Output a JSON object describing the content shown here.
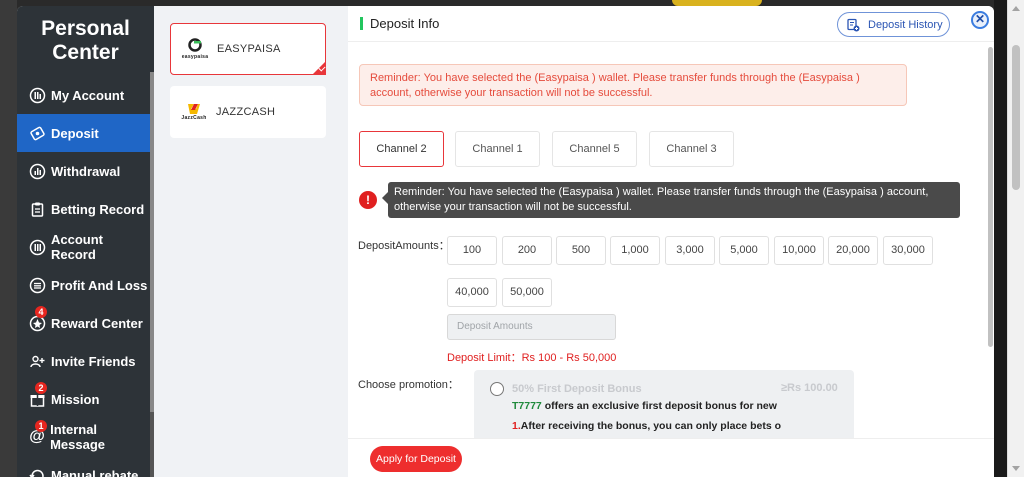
{
  "sidebar": {
    "title_line1": "Personal",
    "title_line2": "Center",
    "items": [
      {
        "label": "My Account"
      },
      {
        "label": "Deposit"
      },
      {
        "label": "Withdrawal"
      },
      {
        "label": "Betting Record"
      },
      {
        "label": "Account Record"
      },
      {
        "label": "Profit And Loss"
      },
      {
        "label": "Reward Center",
        "badge": "4"
      },
      {
        "label": "Invite Friends"
      },
      {
        "label": "Mission",
        "badge": "2"
      },
      {
        "label": "Internal Message",
        "badge": "1"
      },
      {
        "label": "Manual rebate"
      }
    ]
  },
  "wallets": [
    {
      "name": "EASYPAISA",
      "logo_text": "easypaisa",
      "selected": true
    },
    {
      "name": "JAZZCASH",
      "logo_text": "JazzCash",
      "selected": false
    }
  ],
  "header": {
    "title": "Deposit Info",
    "history_label": "Deposit History",
    "close_symbol": "✕"
  },
  "reminder": "Reminder: You have selected the (Easypaisa ) wallet. Please transfer funds through the (Easypaisa ) account, otherwise your transaction will not be successful.",
  "channels": [
    "Channel 2",
    "Channel 1",
    "Channel 5",
    "Channel 3"
  ],
  "tooltip": "Reminder: You have selected the (Easypaisa ) wallet. Please transfer funds through the (Easypaisa ) account, otherwise your transaction will not be successful.",
  "warn_symbol": "!",
  "amounts": {
    "label": "DepositAmounts：",
    "options": [
      "100",
      "200",
      "500",
      "1,000",
      "3,000",
      "5,000",
      "10,000",
      "20,000",
      "30,000",
      "40,000",
      "50,000"
    ],
    "placeholder": "Deposit Amounts",
    "limit_text": "Deposit Limit：Rs  100  - Rs  50,000"
  },
  "promotion": {
    "label": "Choose promotion：",
    "title": "50% First Deposit Bonus",
    "min": "≥Rs  100.00",
    "brand": "T7777",
    "line1_rest": " offers an exclusive first deposit bonus for new",
    "line2_num": "1.",
    "line2_rest": "After receiving the bonus, you can only place bets o"
  },
  "footer": {
    "apply_label": "Apply for Deposit"
  },
  "colors": {
    "accent_red": "#e8363a",
    "sidebar_bg": "#2d3338",
    "active_blue": "#1f66c6"
  }
}
